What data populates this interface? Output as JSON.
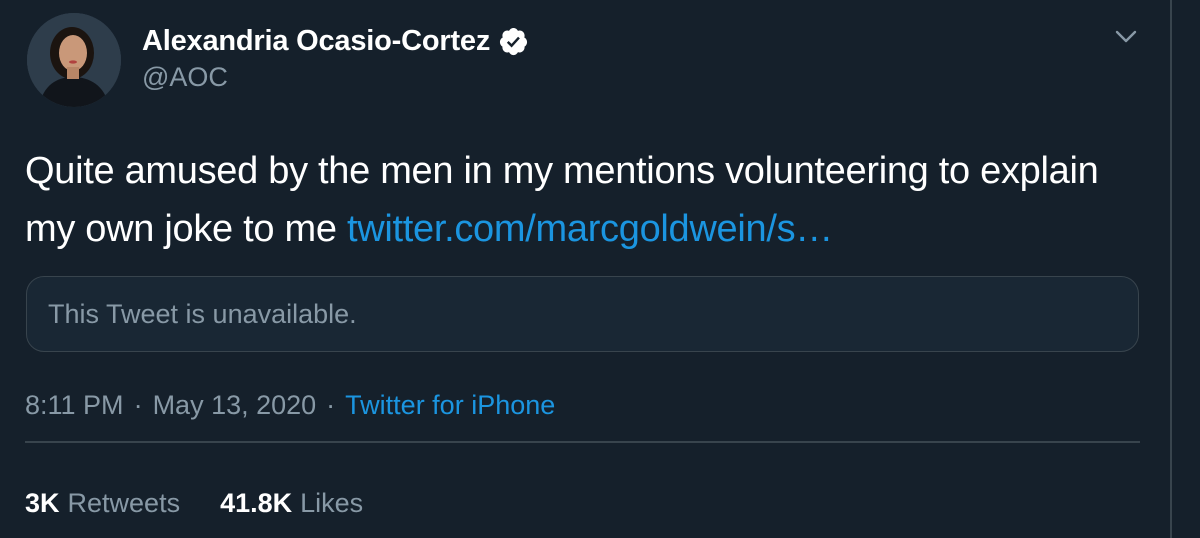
{
  "author": {
    "display_name": "Alexandria Ocasio-Cortez",
    "handle": "@AOC",
    "verified": true,
    "verified_color": "#ffffff"
  },
  "icons": {
    "avatar": "avatar-photo",
    "verified": "verified-badge-icon",
    "menu": "chevron-down-icon"
  },
  "tweet": {
    "text": "Quite amused by the men in my mentions volunteering to explain my own joke to me",
    "link_text": "twitter.com/marcgoldwein/s…"
  },
  "quoted_tweet": {
    "text": "This Tweet is unavailable."
  },
  "meta": {
    "time": "8:11 PM",
    "separator": "·",
    "date": "May 13, 2020",
    "source": "Twitter for iPhone"
  },
  "stats": {
    "retweets_count": "3K",
    "retweets_label": "Retweets",
    "likes_count": "41.8K",
    "likes_label": "Likes"
  },
  "colors": {
    "background": "#15202b",
    "text": "#ffffff",
    "secondary_text": "#8899a6",
    "link": "#1b95e0",
    "border": "#38444d"
  }
}
